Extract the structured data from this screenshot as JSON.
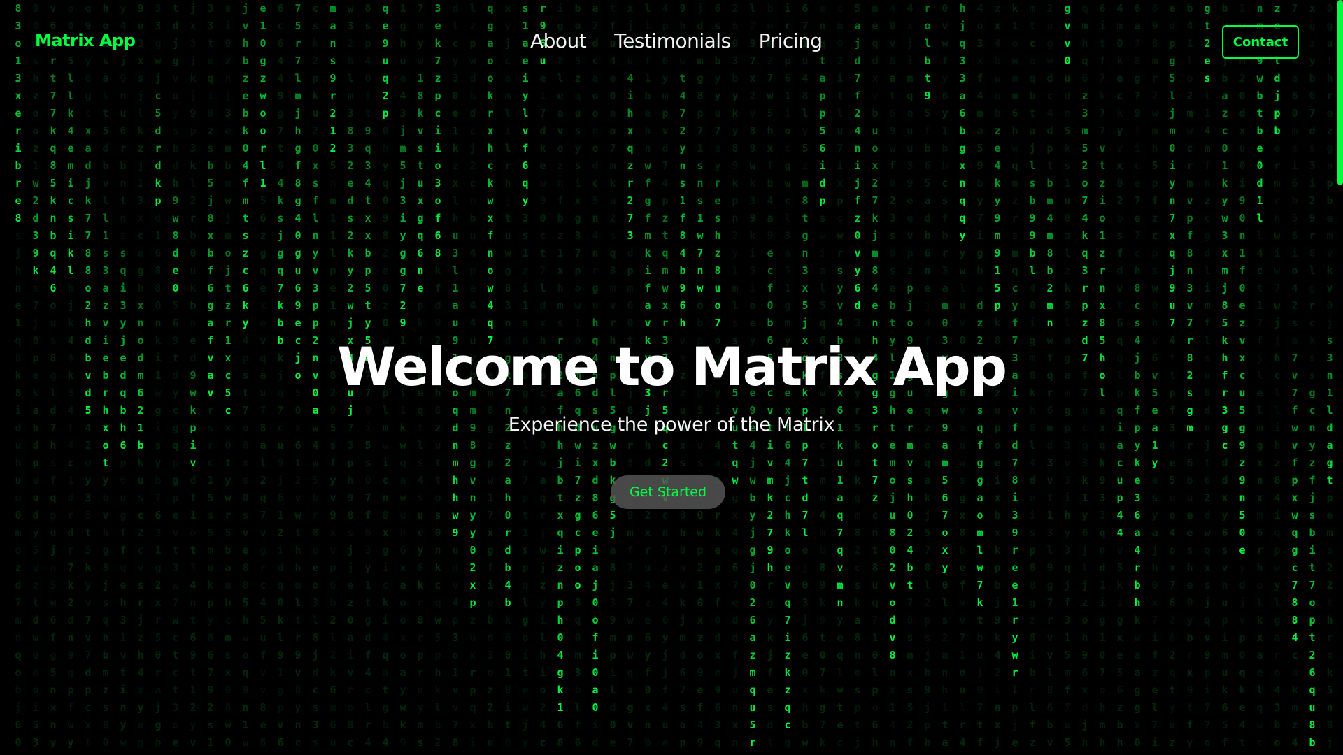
{
  "theme": {
    "accent": "#00ff41",
    "background": "#000000",
    "text": "#ffffff"
  },
  "navbar": {
    "logo": "Matrix App",
    "links": [
      "About",
      "Testimonials",
      "Pricing"
    ],
    "contact_label": "Contact"
  },
  "hero": {
    "title": "Welcome to Matrix App",
    "subtitle": "Experience the power of the Matrix",
    "cta_label": "Get Started"
  },
  "background_effect": {
    "name": "matrix-digital-rain",
    "glyph_set": "abcdefghijklmnopqrstuvwxyz0123456789",
    "color": "#00ff41"
  }
}
